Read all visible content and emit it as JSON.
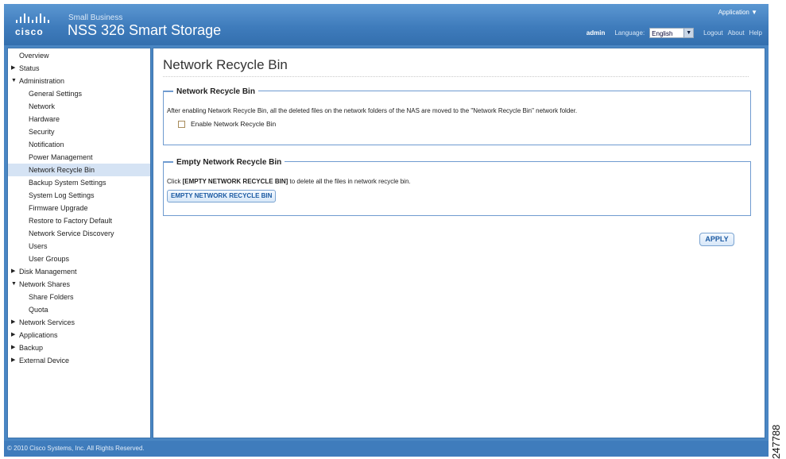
{
  "header": {
    "brand": "cisco",
    "small_business_label": "Small Business",
    "product_name": "NSS 326 Smart Storage",
    "application_menu": "Application ▼",
    "user": "admin",
    "language_label": "Language:",
    "language_value": "English",
    "logout": "Logout",
    "about": "About",
    "help": "Help"
  },
  "sidebar": {
    "items": [
      {
        "label": "Overview",
        "level": 0,
        "arrow": ""
      },
      {
        "label": "Status",
        "level": 0,
        "arrow": "right"
      },
      {
        "label": "Administration",
        "level": 0,
        "arrow": "down"
      },
      {
        "label": "General Settings",
        "level": 1,
        "arrow": ""
      },
      {
        "label": "Network",
        "level": 1,
        "arrow": ""
      },
      {
        "label": "Hardware",
        "level": 1,
        "arrow": ""
      },
      {
        "label": "Security",
        "level": 1,
        "arrow": ""
      },
      {
        "label": "Notification",
        "level": 1,
        "arrow": ""
      },
      {
        "label": "Power Management",
        "level": 1,
        "arrow": ""
      },
      {
        "label": "Network Recycle Bin",
        "level": 1,
        "arrow": "",
        "active": true
      },
      {
        "label": "Backup System Settings",
        "level": 1,
        "arrow": ""
      },
      {
        "label": "System Log Settings",
        "level": 1,
        "arrow": ""
      },
      {
        "label": "Firmware Upgrade",
        "level": 1,
        "arrow": ""
      },
      {
        "label": "Restore to Factory Default",
        "level": 1,
        "arrow": ""
      },
      {
        "label": "Network Service Discovery",
        "level": 1,
        "arrow": ""
      },
      {
        "label": "Users",
        "level": 1,
        "arrow": ""
      },
      {
        "label": "User Groups",
        "level": 1,
        "arrow": ""
      },
      {
        "label": "Disk Management",
        "level": 0,
        "arrow": "right"
      },
      {
        "label": "Network Shares",
        "level": 0,
        "arrow": "down"
      },
      {
        "label": "Share Folders",
        "level": 1,
        "arrow": ""
      },
      {
        "label": "Quota",
        "level": 1,
        "arrow": ""
      },
      {
        "label": "Network Services",
        "level": 0,
        "arrow": "right"
      },
      {
        "label": "Applications",
        "level": 0,
        "arrow": "right"
      },
      {
        "label": "Backup",
        "level": 0,
        "arrow": "right"
      },
      {
        "label": "External Device",
        "level": 0,
        "arrow": "right"
      }
    ]
  },
  "main": {
    "page_title": "Network Recycle Bin",
    "recycle_section": {
      "legend": "Network Recycle Bin",
      "description": "After enabling Network Recycle Bin, all the deleted files on the network folders of the NAS are moved to the \"Network Recycle Bin\" network folder.",
      "checkbox_label": "Enable Network Recycle Bin",
      "checkbox_checked": false
    },
    "empty_section": {
      "legend": "Empty Network Recycle Bin",
      "description_prefix": "Click ",
      "description_bold": "[EMPTY NETWORK RECYCLE BIN]",
      "description_suffix": " to delete all the files in network recycle bin.",
      "button_label": "EMPTY NETWORK RECYCLE BIN"
    },
    "apply_label": "APPLY"
  },
  "footer": {
    "copyright": "© 2010 Cisco Systems, Inc. All Rights Reserved."
  },
  "figure_id": "247788"
}
